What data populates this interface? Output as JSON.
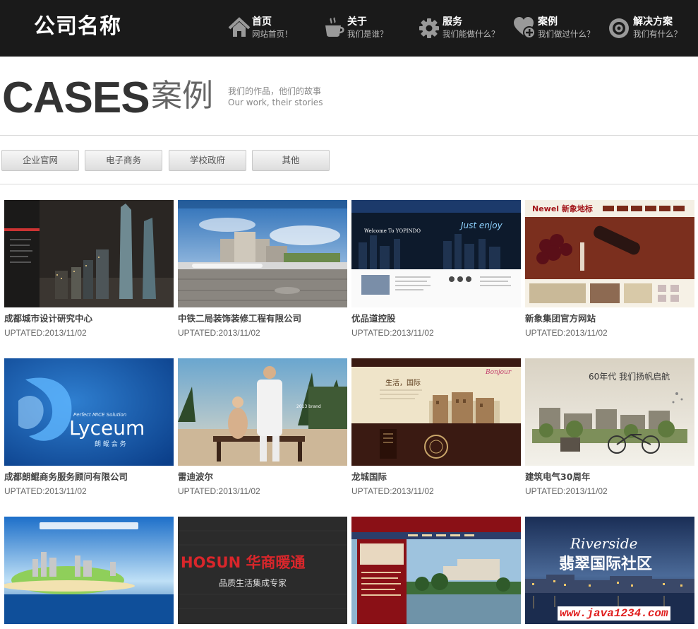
{
  "header": {
    "logo": "公司名称",
    "nav": [
      {
        "title": "首页",
        "sub": "网站首页！",
        "icon": "home-icon"
      },
      {
        "title": "关于",
        "sub": "我们是谁？",
        "icon": "coffee-cup-icon"
      },
      {
        "title": "服务",
        "sub": "我们能做什么？",
        "icon": "gear-icon"
      },
      {
        "title": "案例",
        "sub": "我们做过什么？",
        "icon": "heart-plus-icon"
      },
      {
        "title": "解决方案",
        "sub": "我们有什么？",
        "icon": "target-icon"
      }
    ]
  },
  "page": {
    "title_en": "CASES",
    "title_cn": "案例",
    "subtitle_cn": "我们的作品，他们的故事",
    "subtitle_en": "Our work, their stories"
  },
  "filters": [
    "企业官网",
    "电子商务",
    "学校政府",
    "其他"
  ],
  "cases": [
    {
      "name": "成都城市设计研究中心",
      "date": "UPTATED:2013/11/02",
      "thumb_text": ""
    },
    {
      "name": "中铁二局装饰装修工程有限公司",
      "date": "UPTATED:2013/11/02",
      "thumb_text": ""
    },
    {
      "name": "优品道控股",
      "date": "UPTATED:2013/11/02",
      "thumb_text": "Welcome To YOPINDO"
    },
    {
      "name": "新象集团官方网站",
      "date": "UPTATED:2013/11/02",
      "thumb_text": "Newel 新象地标"
    },
    {
      "name": "成都朗鲲商务服务顾问有限公司",
      "date": "UPTATED:2013/11/02",
      "thumb_text": "Lyceum"
    },
    {
      "name": "雷迪波尔",
      "date": "UPTATED:2013/11/02",
      "thumb_text": ""
    },
    {
      "name": "龙城国际",
      "date": "UPTATED:2013/11/02",
      "thumb_text": "生活，国际"
    },
    {
      "name": "建筑电气30周年",
      "date": "UPTATED:2013/11/02",
      "thumb_text": "60年代 我们扬帆启航"
    },
    {
      "name": "",
      "date": "",
      "thumb_text": ""
    },
    {
      "name": "",
      "date": "",
      "thumb_text": "HOSUN 华商暖通"
    },
    {
      "name": "",
      "date": "",
      "thumb_text": ""
    },
    {
      "name": "",
      "date": "",
      "thumb_text": "Riverside 翡翠国际社区"
    }
  ],
  "thumb_extra": {
    "lyceum_tag": "Perfect MICE Solution",
    "lyceum_cn": "朗 鲲 会 务",
    "hosun_sub": "品质生活集成专家"
  },
  "watermark": "www.java1234.com",
  "colors": {
    "header_bg": "#1a1a1a",
    "watermark": "#e02020"
  }
}
